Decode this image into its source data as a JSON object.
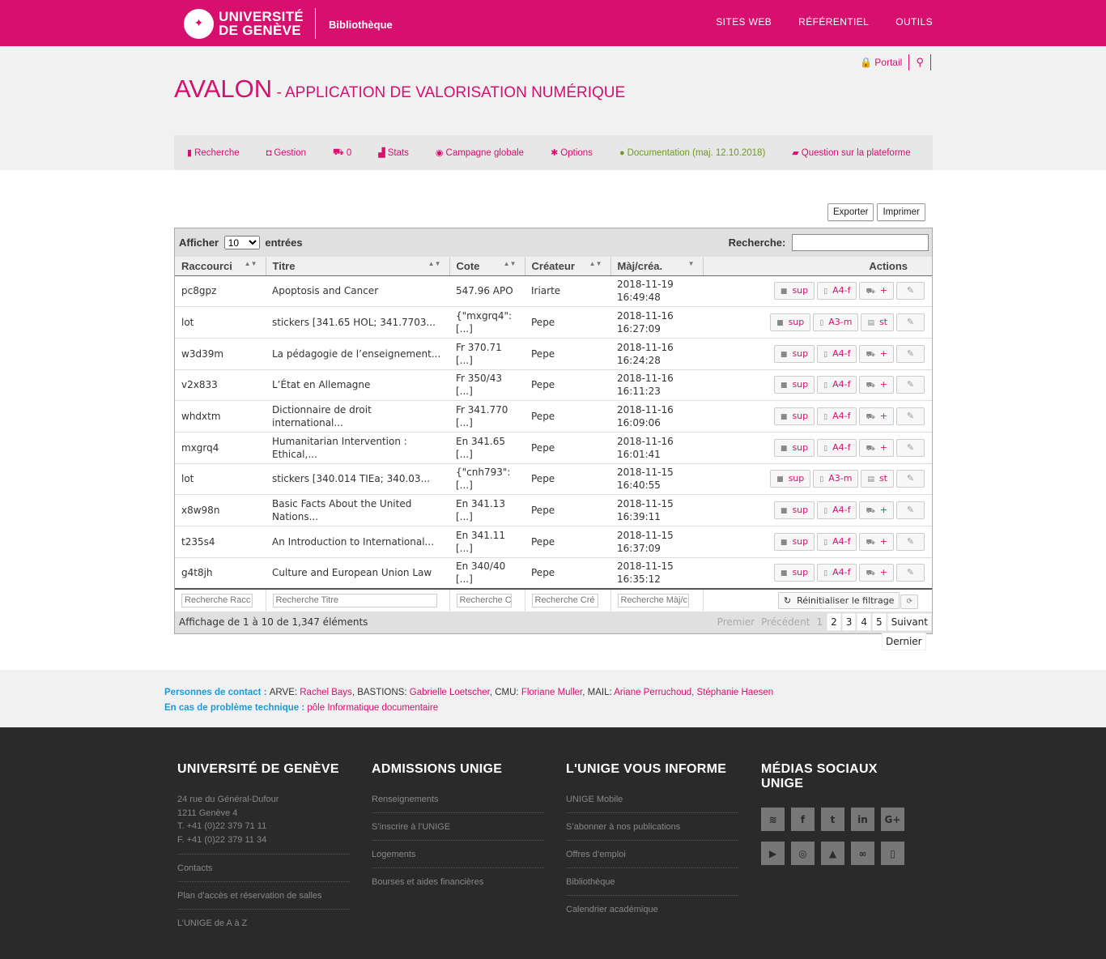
{
  "topbar": {
    "university_line1": "UNIVERSITÉ",
    "university_line2": "DE GENÈVE",
    "site_name": "Bibliothèque",
    "nav": [
      "SITES WEB",
      "RÉFÉRENTIEL",
      "OUTILS"
    ]
  },
  "header": {
    "portal_label": "Portail",
    "title_main": "AVALON",
    "title_sub": " - APPLICATION DE VALORISATION NUMÉRIQUE"
  },
  "mainnav": {
    "items": [
      {
        "icon": "file-icon",
        "label": "Recherche"
      },
      {
        "icon": "inbox-icon",
        "label": "Gestion"
      },
      {
        "icon": "cart-icon",
        "label": "0"
      },
      {
        "icon": "bar-chart-icon",
        "label": "Stats"
      },
      {
        "icon": "globe-icon",
        "label": "Campagne globale"
      },
      {
        "icon": "gear-icon",
        "label": "Options"
      },
      {
        "icon": "help-circle-icon",
        "label": "Documentation (maj. 12.10.2018)"
      },
      {
        "icon": "comment-icon",
        "label": "Question sur la plateforme"
      }
    ]
  },
  "tools": {
    "export": "Exporter",
    "print": "Imprimer"
  },
  "table": {
    "show_label": "Afficher",
    "show_value": "10",
    "entries_label": "entrées",
    "search_label": "Recherche:",
    "columns": [
      "Raccourci",
      "Titre",
      "Cote",
      "Créateur",
      "Màj/créa.",
      "Actions"
    ],
    "rows": [
      {
        "raccourci": "pc8gpz",
        "titre": "Apoptosis and Cancer",
        "cote": "547.96 APO",
        "createur": "Iriarte",
        "date": "2018-11-19",
        "heure": "16:49:48",
        "btn1": "sup",
        "btn2": "A4-f",
        "btn3": "+"
      },
      {
        "raccourci": "lot",
        "titre": "stickers [341.65 HOL; 341.7703...",
        "cote": "{\"mxgrq4\":",
        "cote2": "[...]",
        "createur": "Pepe",
        "date": "2018-11-16",
        "heure": "16:27:09",
        "btn1": "sup",
        "btn2": "A3-m",
        "btn3": "st"
      },
      {
        "raccourci": "w3d39m",
        "titre": "La pédagogie de l’enseignement...",
        "cote": "Fr 370.71",
        "cote2": "[...]",
        "createur": "Pepe",
        "date": "2018-11-16",
        "heure": "16:24:28",
        "btn1": "sup",
        "btn2": "A4-f",
        "btn3": "+"
      },
      {
        "raccourci": "v2x833",
        "titre": "L’État en Allemagne",
        "cote": "Fr 350/43",
        "cote2": "[...]",
        "createur": "Pepe",
        "date": "2018-11-16",
        "heure": "16:11:23",
        "btn1": "sup",
        "btn2": "A4-f",
        "btn3": "+"
      },
      {
        "raccourci": "whdxtm",
        "titre": "Dictionnaire de droit international...",
        "cote": "Fr 341.770",
        "cote2": "[...]",
        "createur": "Pepe",
        "date": "2018-11-16",
        "heure": "16:09:06",
        "btn1": "sup",
        "btn2": "A4-f",
        "btn3": "+"
      },
      {
        "raccourci": "mxgrq4",
        "titre": "Humanitarian Intervention :",
        "titre2": "Ethical,...",
        "cote": "En 341.65",
        "cote2": "[...]",
        "createur": "Pepe",
        "date": "2018-11-16",
        "heure": "16:01:41",
        "btn1": "sup",
        "btn2": "A4-f",
        "btn3": "+"
      },
      {
        "raccourci": "lot",
        "titre": "stickers [340.014 TIEa; 340.03...",
        "cote": "{\"cnh793\":",
        "cote2": "[...]",
        "createur": "Pepe",
        "date": "2018-11-15",
        "heure": "16:40:55",
        "btn1": "sup",
        "btn2": "A3-m",
        "btn3": "st"
      },
      {
        "raccourci": "x8w98n",
        "titre": "Basic Facts About the United",
        "titre2": "Nations...",
        "cote": "En 341.13",
        "cote2": "[...]",
        "createur": "Pepe",
        "date": "2018-11-15",
        "heure": "16:39:11",
        "btn1": "sup",
        "btn2": "A4-f",
        "btn3": "+"
      },
      {
        "raccourci": "t235s4",
        "titre": "An Introduction to International...",
        "cote": "En 341.11",
        "cote2": "[...]",
        "createur": "Pepe",
        "date": "2018-11-15",
        "heure": "16:37:09",
        "btn1": "sup",
        "btn2": "A4-f",
        "btn3": "+"
      },
      {
        "raccourci": "g4t8jh",
        "titre": "Culture and European Union Law",
        "cote": "En 340/40",
        "cote2": "[...]",
        "createur": "Pepe",
        "date": "2018-11-15",
        "heure": "16:35:12",
        "btn1": "sup",
        "btn2": "A4-f",
        "btn3": "+"
      }
    ],
    "filters": [
      "Recherche Racc",
      "Recherche Titre",
      "Recherche C",
      "Recherche Cré",
      "Recherche Màj/c"
    ],
    "reset_label": "Réinitialiser le filtrage",
    "info": "Affichage de 1 à 10 de 1,347 éléments",
    "pager": {
      "first": "Premier",
      "prev": "Précédent",
      "current": "1",
      "pages": [
        "2",
        "3",
        "4",
        "5"
      ],
      "next": "Suivant",
      "last": "Dernier"
    }
  },
  "contact": {
    "label1": "Personnes de contact",
    "sep": " : ",
    "g1": "ARVE: ",
    "n1": "Rachel Bays",
    "g2": ", BASTIONS: ",
    "n2": "Gabrielle Loetscher",
    "g3": ", CMU: ",
    "n3": "Floriane Muller",
    "g4": ", MAIL: ",
    "n4": "Ariane Perruchoud, Stéphanie Haesen",
    "label2": "En cas de problème technique",
    "n5": "pôle Informatique documentaire"
  },
  "footer": {
    "col1": {
      "title": "UNIVERSITÉ DE GENÈVE",
      "addr": [
        "24 rue du Général-Dufour",
        "1211 Genève 4",
        "T. +41 (0)22 379 71 11",
        "F. +41 (0)22 379 11 34"
      ],
      "links": [
        "Contacts",
        "Plan d’accès et réservation de salles",
        "L’UNIGE de A à Z"
      ]
    },
    "col2": {
      "title": "ADMISSIONS UNIGE",
      "links": [
        "Renseignements",
        "S’inscrire à l’UNIGE",
        "Logements",
        "Bourses et aides financières"
      ]
    },
    "col3": {
      "title": "L'UNIGE VOUS INFORME",
      "links": [
        "UNIGE Mobile",
        "S’abonner à nos publications",
        "Offres d’emploi",
        "Bibliothèque",
        "Calendrier académique"
      ]
    },
    "col4": {
      "title": "MÉDIAS SOCIAUX UNIGE"
    }
  }
}
